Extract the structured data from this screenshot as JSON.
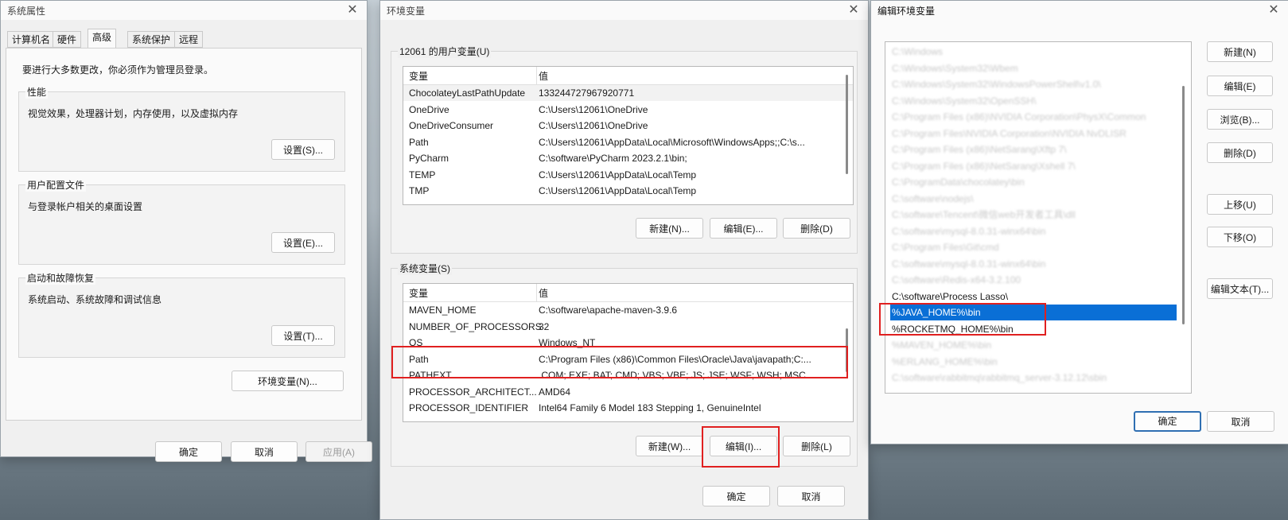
{
  "sysprops": {
    "title": "系统属性",
    "tabs": [
      "计算机名",
      "硬件",
      "高级",
      "系统保护",
      "远程"
    ],
    "admin_note": "要进行大多数更改，你必须作为管理员登录。",
    "performance": {
      "label": "性能",
      "desc": "视觉效果，处理器计划，内存使用，以及虚拟内存",
      "button": "设置(S)..."
    },
    "profiles": {
      "label": "用户配置文件",
      "desc": "与登录帐户相关的桌面设置",
      "button": "设置(E)..."
    },
    "startup": {
      "label": "启动和故障恢复",
      "desc": "系统启动、系统故障和调试信息",
      "button": "设置(T)..."
    },
    "env_button": "环境变量(N)...",
    "ok": "确定",
    "cancel": "取消",
    "apply": "应用(A)"
  },
  "envvars": {
    "title": "环境变量",
    "user_group": "12061 的用户变量(U)",
    "col_var": "变量",
    "col_val": "值",
    "user_rows": [
      {
        "name": "ChocolateyLastPathUpdate",
        "value": "133244727967920771"
      },
      {
        "name": "OneDrive",
        "value": "C:\\Users\\12061\\OneDrive"
      },
      {
        "name": "OneDriveConsumer",
        "value": "C:\\Users\\12061\\OneDrive"
      },
      {
        "name": "Path",
        "value": "C:\\Users\\12061\\AppData\\Local\\Microsoft\\WindowsApps;;C:\\s..."
      },
      {
        "name": "PyCharm",
        "value": "C:\\software\\PyCharm 2023.2.1\\bin;"
      },
      {
        "name": "TEMP",
        "value": "C:\\Users\\12061\\AppData\\Local\\Temp"
      },
      {
        "name": "TMP",
        "value": "C:\\Users\\12061\\AppData\\Local\\Temp"
      }
    ],
    "user_new": "新建(N)...",
    "user_edit": "编辑(E)...",
    "user_delete": "删除(D)",
    "sys_group": "系统变量(S)",
    "sys_rows": [
      {
        "name": "MAVEN_HOME",
        "value": "C:\\software\\apache-maven-3.9.6"
      },
      {
        "name": "NUMBER_OF_PROCESSORS",
        "value": "32"
      },
      {
        "name": "OS",
        "value": "Windows_NT"
      },
      {
        "name": "Path",
        "value": "C:\\Program Files (x86)\\Common Files\\Oracle\\Java\\javapath;C:..."
      },
      {
        "name": "PATHEXT",
        "value": ".COM;.EXE;.BAT;.CMD;.VBS;.VBE;.JS;.JSE;.WSF;.WSH;.MSC"
      },
      {
        "name": "PROCESSOR_ARCHITECT...",
        "value": "AMD64"
      },
      {
        "name": "PROCESSOR_IDENTIFIER",
        "value": "Intel64 Family 6 Model 183 Stepping 1, GenuineIntel"
      }
    ],
    "sys_new": "新建(W)...",
    "sys_edit": "编辑(I)...",
    "sys_delete": "删除(L)",
    "ok": "确定",
    "cancel": "取消"
  },
  "editenv": {
    "title": "编辑环境变量",
    "paths": [
      {
        "text": "C:\\Windows",
        "blurred": true
      },
      {
        "text": "C:\\Windows\\System32\\Wbem",
        "blurred": true
      },
      {
        "text": "C:\\Windows\\System32\\WindowsPowerShell\\v1.0\\",
        "blurred": true
      },
      {
        "text": "C:\\Windows\\System32\\OpenSSH\\",
        "blurred": true
      },
      {
        "text": "C:\\Program Files (x86)\\NVIDIA Corporation\\PhysX\\Common",
        "blurred": true
      },
      {
        "text": "C:\\Program Files\\NVIDIA Corporation\\NVIDIA NvDLISR",
        "blurred": true
      },
      {
        "text": "C:\\Program Files (x86)\\NetSarang\\Xftp 7\\",
        "blurred": true
      },
      {
        "text": "C:\\Program Files (x86)\\NetSarang\\Xshell 7\\",
        "blurred": true
      },
      {
        "text": "C:\\ProgramData\\chocolatey\\bin",
        "blurred": true
      },
      {
        "text": "C:\\software\\nodejs\\",
        "blurred": true
      },
      {
        "text": "C:\\software\\Tencent\\微信web开发者工具\\dll",
        "blurred": true
      },
      {
        "text": "C:\\software\\mysql-8.0.31-winx64\\bin",
        "blurred": true
      },
      {
        "text": "C:\\Program Files\\Git\\cmd",
        "blurred": true
      },
      {
        "text": "C:\\software\\mysql-8.0.31-winx64\\bin",
        "blurred": true
      },
      {
        "text": "C:\\software\\Redis-x64-3.2.100",
        "blurred": true
      },
      {
        "text": "C:\\software\\Process Lasso\\",
        "blurred": false
      },
      {
        "text": "%JAVA_HOME%\\bin",
        "blurred": false,
        "selected": true
      },
      {
        "text": "%ROCKETMQ_HOME%\\bin",
        "blurred": false
      },
      {
        "text": "%MAVEN_HOME%\\bin",
        "blurred": true
      },
      {
        "text": "%ERLANG_HOME%\\bin",
        "blurred": true
      },
      {
        "text": "C:\\software\\rabbitmq\\rabbitmq_server-3.12.12\\sbin",
        "blurred": true
      }
    ],
    "buttons": {
      "new": "新建(N)",
      "edit": "编辑(E)",
      "browse": "浏览(B)...",
      "delete": "删除(D)",
      "move_up": "上移(U)",
      "move_down": "下移(O)",
      "edit_text": "编辑文本(T)..."
    },
    "ok": "确定",
    "cancel": "取消"
  },
  "colors": {
    "highlight": "#e02020",
    "selection": "#0a6fd6"
  }
}
